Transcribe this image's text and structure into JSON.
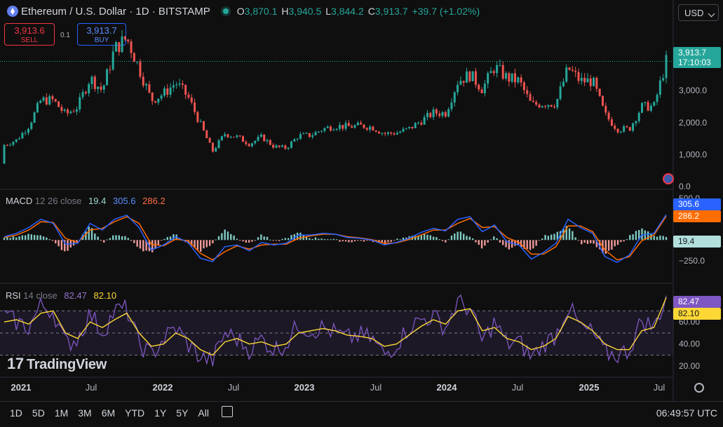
{
  "header": {
    "title": "Ethereum / U.S. Dollar · 1D · BITSTAMP",
    "ohlc": [
      {
        "k": "O",
        "v": "3,870.1"
      },
      {
        "k": "H",
        "v": "3,940.5"
      },
      {
        "k": "L",
        "v": "3,844.2"
      },
      {
        "k": "C",
        "v": "3,913.7"
      }
    ],
    "change": "+39.7 (+1.02%)",
    "currency": "USD"
  },
  "trade": {
    "sell_price": "3,913.6",
    "sell_label": "SELL",
    "buy_price": "3,913.7",
    "buy_label": "BUY",
    "spread": "0.1"
  },
  "price_tags": {
    "last": "3,913.7",
    "countdown": "17:10:03"
  },
  "macd": {
    "label": "MACD",
    "params": "12 26 close",
    "hist": "19.4",
    "macd": "305.6",
    "signal": "286.2"
  },
  "rsi": {
    "label": "RSI",
    "params": "14 close",
    "rsi": "82.47",
    "ma": "82.10"
  },
  "ranges": [
    "1D",
    "5D",
    "1M",
    "3M",
    "6M",
    "YTD",
    "1Y",
    "5Y",
    "All"
  ],
  "clock": "06:49:57 UTC",
  "logo": "TradingView",
  "colors": {
    "up": "#26a69a",
    "down": "#ef5350",
    "macd": "#2962ff",
    "signal": "#ff6d00",
    "rsi": "#7e57c2",
    "rsi_ma": "#fdd835",
    "bg": "#0f0f0f"
  },
  "chart_data": [
    {
      "type": "candlestick",
      "title": "Ethereum / U.S. Dollar · 1D · BITSTAMP",
      "ylim": [
        0,
        5000
      ],
      "yticks": [
        0,
        1000,
        2000,
        3000,
        4000
      ],
      "ytick_labels": [
        "0.0",
        "1,000.0",
        "2,000.0",
        "3,000.0",
        "4,000.0"
      ],
      "x_labels": [
        "2021",
        "Jul",
        "2022",
        "Jul",
        "2023",
        "Jul",
        "2024",
        "Jul",
        "2025",
        "Jul"
      ],
      "x": [
        "2021-01",
        "2021-02",
        "2021-03",
        "2021-04",
        "2021-05",
        "2021-06",
        "2021-07",
        "2021-08",
        "2021-09",
        "2021-10",
        "2021-11",
        "2021-12",
        "2022-01",
        "2022-02",
        "2022-03",
        "2022-04",
        "2022-05",
        "2022-06",
        "2022-07",
        "2022-08",
        "2022-09",
        "2022-10",
        "2022-11",
        "2022-12",
        "2023-01",
        "2023-02",
        "2023-03",
        "2023-04",
        "2023-05",
        "2023-06",
        "2023-07",
        "2023-08",
        "2023-09",
        "2023-10",
        "2023-11",
        "2023-12",
        "2024-01",
        "2024-02",
        "2024-03",
        "2024-04",
        "2024-05",
        "2024-06",
        "2024-07",
        "2024-08",
        "2024-09",
        "2024-10",
        "2024-11",
        "2024-12",
        "2025-01",
        "2025-02",
        "2025-03",
        "2025-04",
        "2025-05",
        "2025-06",
        "2025-07"
      ],
      "close": [
        1300,
        1450,
        1900,
        2700,
        2700,
        2250,
        2500,
        3400,
        3000,
        4300,
        4650,
        3700,
        2700,
        2900,
        3250,
        2800,
        1950,
        1100,
        1650,
        1550,
        1330,
        1550,
        1250,
        1200,
        1590,
        1600,
        1800,
        1900,
        1870,
        1900,
        1860,
        1650,
        1680,
        1800,
        2050,
        2300,
        2300,
        3300,
        3500,
        3050,
        3750,
        3400,
        3300,
        2550,
        2600,
        2600,
        3700,
        3300,
        3300,
        2250,
        1800,
        1800,
        2500,
        2500,
        3913.7
      ],
      "last_price": 3913.7
    },
    {
      "type": "bar+line",
      "name": "MACD 12 26 close",
      "yticks": [
        500,
        -250
      ],
      "ytick_labels": [
        "500.0",
        "−250.0"
      ],
      "ylim": [
        -420,
        560
      ],
      "macd": [
        40,
        80,
        150,
        250,
        200,
        -50,
        -40,
        200,
        120,
        250,
        300,
        150,
        -120,
        -60,
        40,
        -30,
        -220,
        -260,
        -80,
        -60,
        -130,
        -30,
        -60,
        -40,
        60,
        60,
        80,
        70,
        30,
        20,
        0,
        -60,
        -30,
        20,
        90,
        140,
        110,
        250,
        280,
        100,
        180,
        -20,
        -60,
        -230,
        -150,
        -40,
        250,
        150,
        80,
        -200,
        -270,
        -180,
        60,
        80,
        305.6
      ],
      "signal": [
        30,
        60,
        120,
        220,
        210,
        20,
        -30,
        120,
        140,
        220,
        280,
        200,
        -50,
        -70,
        10,
        -10,
        -160,
        -240,
        -140,
        -70,
        -110,
        -60,
        -50,
        -50,
        20,
        50,
        70,
        70,
        40,
        25,
        5,
        -40,
        -35,
        5,
        60,
        120,
        120,
        200,
        260,
        150,
        160,
        30,
        -30,
        -170,
        -170,
        -80,
        170,
        170,
        100,
        -120,
        -240,
        -200,
        -10,
        60,
        286.2
      ],
      "last": {
        "hist": 19.4,
        "macd": 305.6,
        "signal": 286.2
      }
    },
    {
      "type": "line",
      "name": "RSI 14 close",
      "ylim": [
        10,
        95
      ],
      "yticks": [
        20,
        40,
        60
      ],
      "ytick_labels": [
        "20.00",
        "40.00",
        "60.00"
      ],
      "bands": [
        30,
        50,
        70
      ],
      "rsi": [
        65,
        60,
        55,
        75,
        70,
        40,
        45,
        68,
        50,
        70,
        72,
        40,
        30,
        45,
        55,
        40,
        28,
        25,
        50,
        45,
        35,
        45,
        35,
        40,
        58,
        52,
        55,
        50,
        45,
        48,
        45,
        30,
        40,
        55,
        62,
        65,
        55,
        78,
        72,
        42,
        60,
        40,
        42,
        28,
        40,
        48,
        75,
        55,
        50,
        32,
        30,
        35,
        62,
        55,
        82.47
      ],
      "rsi_ma": [
        60,
        62,
        58,
        68,
        70,
        50,
        45,
        60,
        55,
        62,
        68,
        50,
        38,
        40,
        50,
        45,
        35,
        30,
        42,
        45,
        40,
        42,
        38,
        40,
        50,
        52,
        54,
        52,
        48,
        47,
        45,
        38,
        40,
        48,
        56,
        62,
        58,
        70,
        72,
        52,
        55,
        45,
        42,
        35,
        38,
        45,
        65,
        60,
        52,
        40,
        35,
        35,
        52,
        55,
        82.1
      ],
      "last": {
        "rsi": 82.47,
        "ma": 82.1
      }
    }
  ]
}
